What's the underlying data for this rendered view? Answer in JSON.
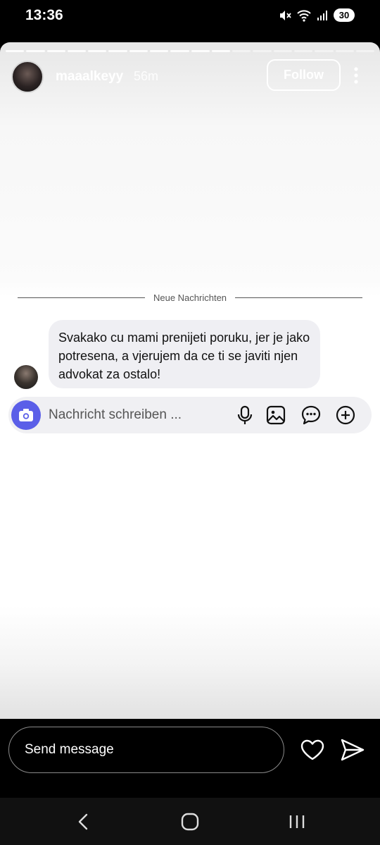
{
  "status_bar": {
    "time": "13:36",
    "battery": "30"
  },
  "story": {
    "progress_total": 18,
    "progress_filled": 11,
    "username": "maaalkeyy",
    "time_ago": "56m",
    "follow_label": "Follow"
  },
  "chat": {
    "divider_text": "Neue Nachrichten",
    "message_text": "Svakako cu mami prenijeti poruku, jer je jako potresena, a vjerujem da ce ti se javiti njen advokat za ostalo!",
    "input_placeholder": "Nachricht schreiben ..."
  },
  "reply": {
    "placeholder": "Send message"
  },
  "icons": {
    "status": [
      "mute-icon",
      "wifi-icon",
      "signal-icon",
      "battery-icon"
    ],
    "composer": [
      "camera-icon",
      "microphone-icon",
      "gallery-icon",
      "sticker-icon",
      "plus-icon"
    ],
    "nav": [
      "back-icon",
      "home-icon",
      "recents-icon"
    ]
  },
  "colors": {
    "accent": "#5b5fe8",
    "bubble": "#efeff3"
  }
}
